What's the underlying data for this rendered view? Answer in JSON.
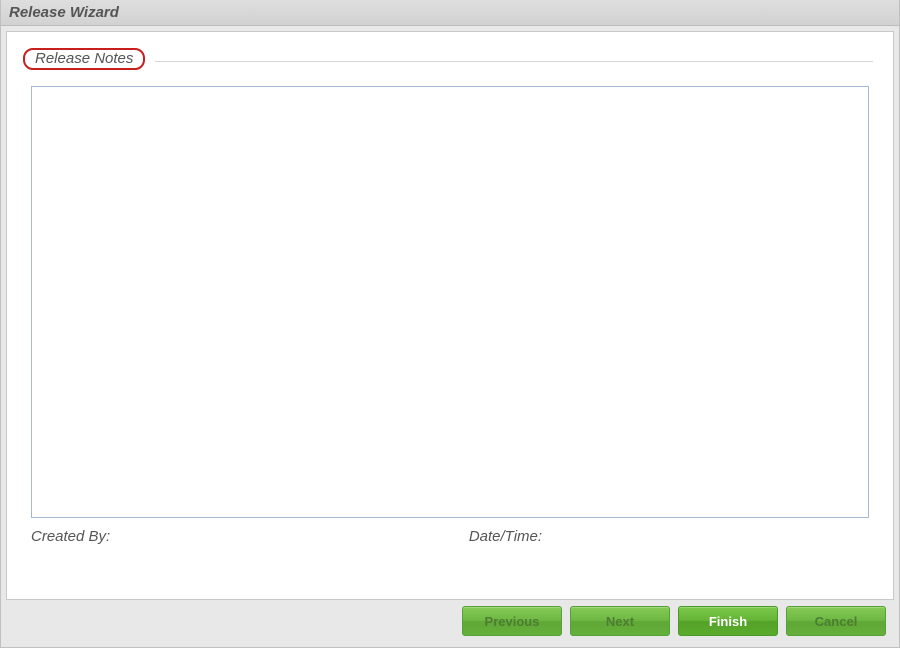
{
  "window": {
    "title": "Release Wizard"
  },
  "section": {
    "header": "Release Notes"
  },
  "notes": {
    "value": ""
  },
  "meta": {
    "created_by_label": "Created By:",
    "created_by_value": "",
    "date_time_label": "Date/Time:",
    "date_time_value": ""
  },
  "buttons": {
    "previous": "Previous",
    "next": "Next",
    "finish": "Finish",
    "cancel": "Cancel"
  }
}
